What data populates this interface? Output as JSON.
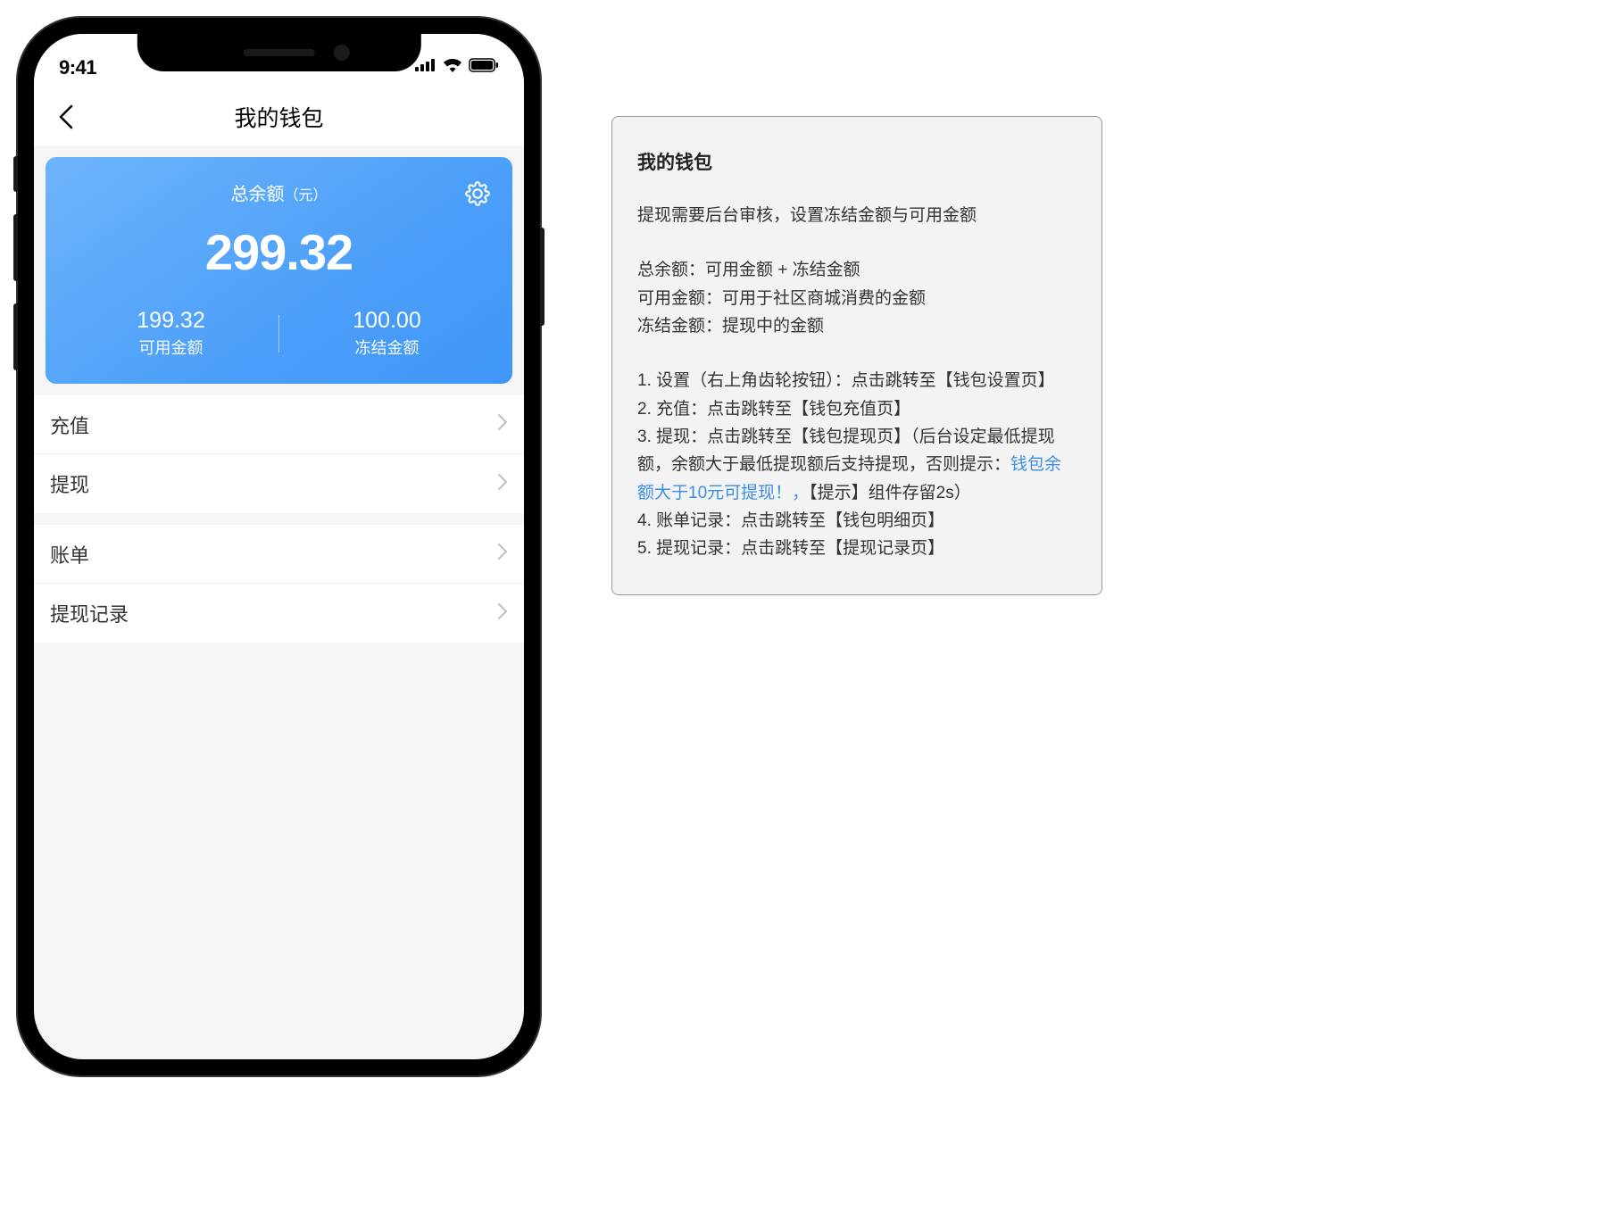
{
  "status_bar": {
    "time": "9:41"
  },
  "nav": {
    "title": "我的钱包"
  },
  "balance": {
    "label_main": "总余额",
    "label_unit": "（元）",
    "total": "299.32",
    "available_value": "199.32",
    "available_label": "可用金额",
    "frozen_value": "100.00",
    "frozen_label": "冻结金额"
  },
  "menu_group_1": {
    "item_0": "充值",
    "item_1": "提现"
  },
  "menu_group_2": {
    "item_0": "账单",
    "item_1": "提现记录"
  },
  "doc": {
    "title": "我的钱包",
    "intro": "提现需要后台审核，设置冻结金额与可用金额",
    "def_1": "总余额：可用金额 + 冻结金额",
    "def_2": "可用金额：可用于社区商城消费的金额",
    "def_3": "冻结金额：提现中的金额",
    "step_1": "1. 设置（右上角齿轮按钮）：点击跳转至【钱包设置页】",
    "step_2": "2. 充值：点击跳转至【钱包充值页】",
    "step_3a": "3. 提现：点击跳转至【钱包提现页】（后台设定最低提现额，余额大于最低提现额后支持提现，否则提示：",
    "step_3_highlight": "钱包余额大于10元可提现！，",
    "step_3b": "【提示】组件存留2s）",
    "step_4": "4. 账单记录：点击跳转至【钱包明细页】",
    "step_5": "5. 提现记录：点击跳转至【提现记录页】"
  }
}
